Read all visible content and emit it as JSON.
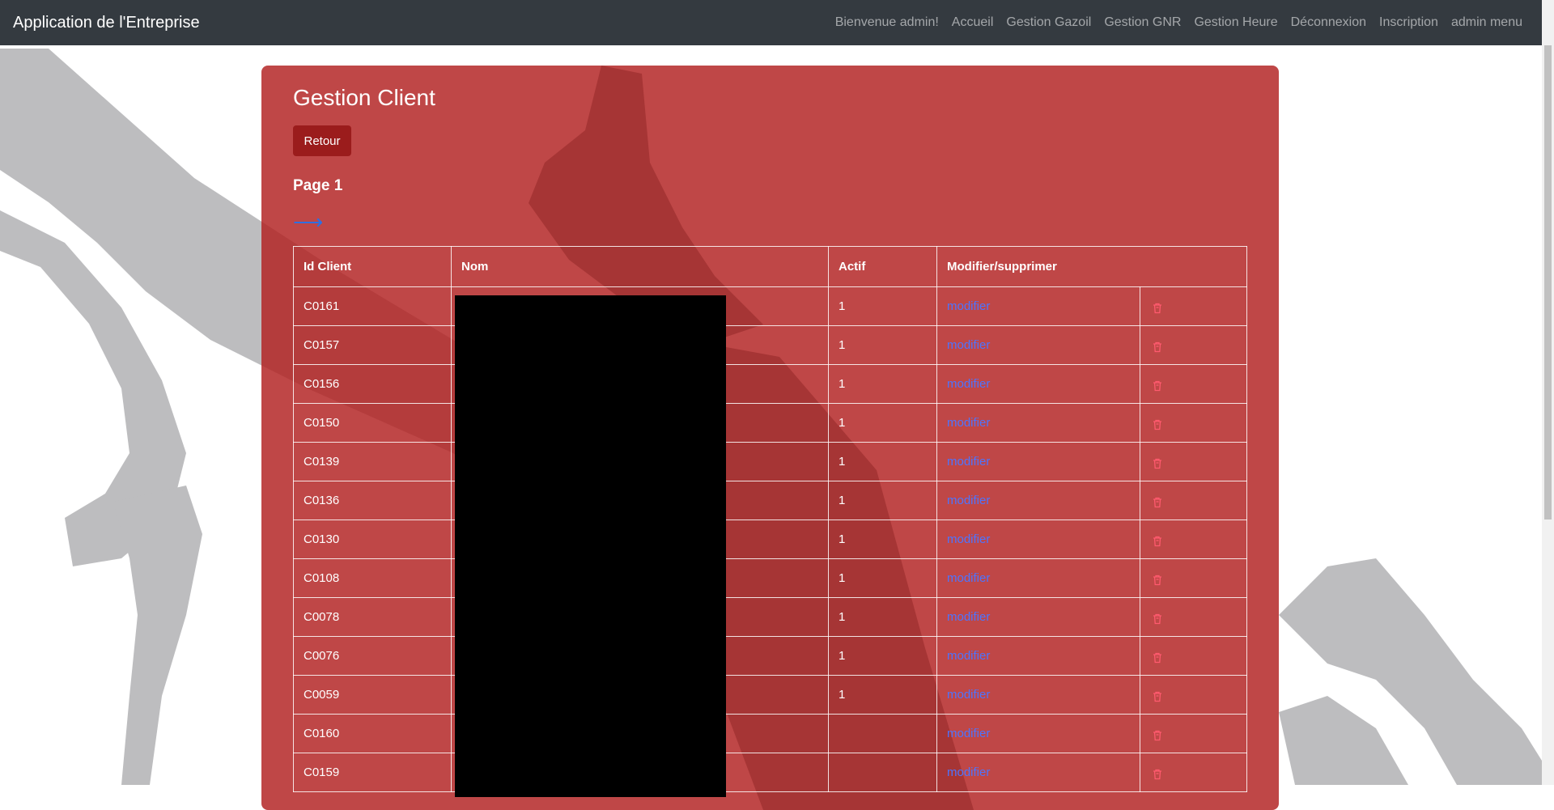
{
  "navbar": {
    "brand": "Application de l'Entreprise",
    "links": [
      "Bienvenue admin!",
      "Accueil",
      "Gestion Gazoil",
      "Gestion GNR",
      "Gestion Heure",
      "Déconnexion",
      "Inscription",
      "admin menu"
    ]
  },
  "main": {
    "title": "Gestion Client",
    "back_label": "Retour",
    "page_label": "Page 1",
    "next_arrow": "⟶"
  },
  "table": {
    "headers": [
      "Id Client",
      "Nom",
      "Actif",
      "Modifier/supprimer"
    ],
    "modify_label": "modifier",
    "delete_icon": "trash-icon",
    "rows": [
      {
        "id": "C0161",
        "actif": "1"
      },
      {
        "id": "C0157",
        "actif": "1"
      },
      {
        "id": "C0156",
        "actif": "1"
      },
      {
        "id": "C0150",
        "actif": "1"
      },
      {
        "id": "C0139",
        "actif": "1"
      },
      {
        "id": "C0136",
        "actif": "1"
      },
      {
        "id": "C0130",
        "actif": "1"
      },
      {
        "id": "C0108",
        "actif": "1"
      },
      {
        "id": "C0078",
        "actif": "1"
      },
      {
        "id": "C0076",
        "actif": "1"
      },
      {
        "id": "C0059",
        "actif": "1"
      },
      {
        "id": "C0160",
        "actif": ""
      },
      {
        "id": "C0159",
        "actif": ""
      }
    ]
  },
  "colors": {
    "navbar": "#343a40",
    "card": "#b22222",
    "link": "#4d74ff",
    "delete_icon": "#ff5a6e"
  }
}
